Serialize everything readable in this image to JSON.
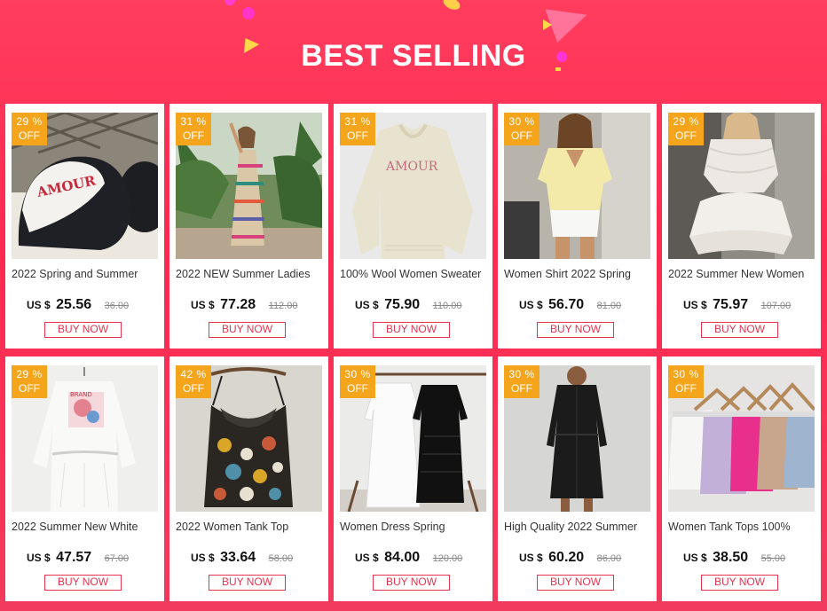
{
  "header": {
    "title": "BEST SELLING"
  },
  "colors": {
    "accent": "#ff2a50",
    "badge": "#f5a51c",
    "button_border": "#e8334f"
  },
  "products": [
    {
      "discount": "29 %",
      "off": "OFF",
      "name": "2022 Spring and Summer",
      "currency": "US $",
      "price": "25.56",
      "old_price": "36.00",
      "button": "BUY NOW",
      "image": "black-white-amour-cap"
    },
    {
      "discount": "31 %",
      "off": "OFF",
      "name": "2022 NEW Summer Ladies",
      "currency": "US $",
      "price": "77.28",
      "old_price": "112.00",
      "button": "BUY NOW",
      "image": "striped-maxi-dress-model"
    },
    {
      "discount": "31 %",
      "off": "OFF",
      "name": "100% Wool Women Sweater",
      "currency": "US $",
      "price": "75.90",
      "old_price": "110.00",
      "button": "BUY NOW",
      "image": "cream-amour-sweater"
    },
    {
      "discount": "30 %",
      "off": "OFF",
      "name": "Women Shirt 2022 Spring",
      "currency": "US $",
      "price": "56.70",
      "old_price": "81.00",
      "button": "BUY NOW",
      "image": "yellow-ruffle-blouse-model"
    },
    {
      "discount": "29 %",
      "off": "OFF",
      "name": "2022 Summer New Women",
      "currency": "US $",
      "price": "75.97",
      "old_price": "107.00",
      "button": "BUY NOW",
      "image": "white-ruffle-set-model"
    },
    {
      "discount": "29 %",
      "off": "OFF",
      "name": "2022 Summer New White",
      "currency": "US $",
      "price": "47.57",
      "old_price": "67.00",
      "button": "BUY NOW",
      "image": "white-printed-shirt-dress"
    },
    {
      "discount": "42 %",
      "off": "OFF",
      "name": "2022 Women Tank Top",
      "currency": "US $",
      "price": "33.64",
      "old_price": "58.00",
      "button": "BUY NOW",
      "image": "printed-silk-tank-top"
    },
    {
      "discount": "30 %",
      "off": "OFF",
      "name": "Women Dress Spring",
      "currency": "US $",
      "price": "84.00",
      "old_price": "120.00",
      "button": "BUY NOW",
      "image": "white-black-lace-dresses"
    },
    {
      "discount": "30 %",
      "off": "OFF",
      "name": "High Quality 2022 Summer",
      "currency": "US $",
      "price": "60.20",
      "old_price": "86.00",
      "button": "BUY NOW",
      "image": "black-shirt-dress-model"
    },
    {
      "discount": "30 %",
      "off": "OFF",
      "name": "Women Tank Tops 100%",
      "currency": "US $",
      "price": "38.50",
      "old_price": "55.00",
      "button": "BUY NOW",
      "image": "silk-camisoles-on-hangers"
    }
  ]
}
